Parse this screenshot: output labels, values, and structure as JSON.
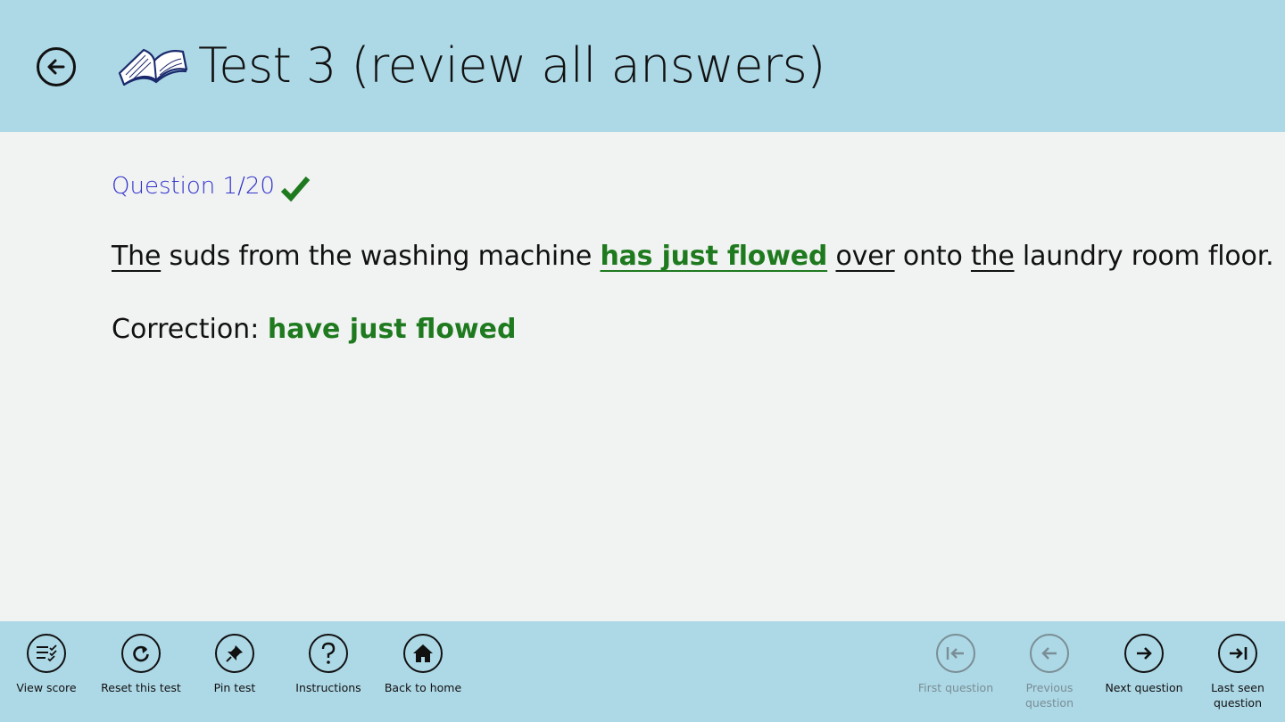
{
  "header": {
    "title": "Test 3 (review all answers)",
    "icons": {
      "back": "back-arrow-icon",
      "book": "open-book-icon"
    }
  },
  "question": {
    "label": "Question 1/20",
    "status_icon": "checkmark-icon",
    "segments": [
      {
        "text": "The",
        "style": "underlined"
      },
      {
        "text": " suds from the washing machine ",
        "style": "plain"
      },
      {
        "text": "has just flowed",
        "style": "selected-correct"
      },
      {
        "text": " ",
        "style": "plain"
      },
      {
        "text": "over",
        "style": "underlined"
      },
      {
        "text": " onto ",
        "style": "plain"
      },
      {
        "text": "the",
        "style": "underlined"
      },
      {
        "text": " laundry room floor.",
        "style": "plain"
      }
    ],
    "correction_label": "Correction:",
    "correction_answer": "have just flowed"
  },
  "appbar": {
    "left": [
      {
        "label": "View score",
        "icon": "score-list-icon"
      },
      {
        "label": "Reset this test",
        "icon": "refresh-icon"
      },
      {
        "label": "Pin test",
        "icon": "pin-icon"
      },
      {
        "label": "Instructions",
        "icon": "question-mark-icon"
      },
      {
        "label": "Back to home",
        "icon": "home-icon"
      }
    ],
    "right": [
      {
        "label": "First question",
        "icon": "first-arrow-icon",
        "enabled": false
      },
      {
        "label": "Previous question",
        "icon": "previous-arrow-icon",
        "enabled": false
      },
      {
        "label": "Next question",
        "icon": "next-arrow-icon",
        "enabled": true
      },
      {
        "label": "Last seen question",
        "icon": "last-arrow-icon",
        "enabled": true
      }
    ]
  },
  "colors": {
    "header_bg": "#add8e6",
    "content_bg": "#f1f3f2",
    "question_label": "#3333cc",
    "correct_green": "#1f7a1f",
    "disabled_gray": "#7a8e95"
  }
}
